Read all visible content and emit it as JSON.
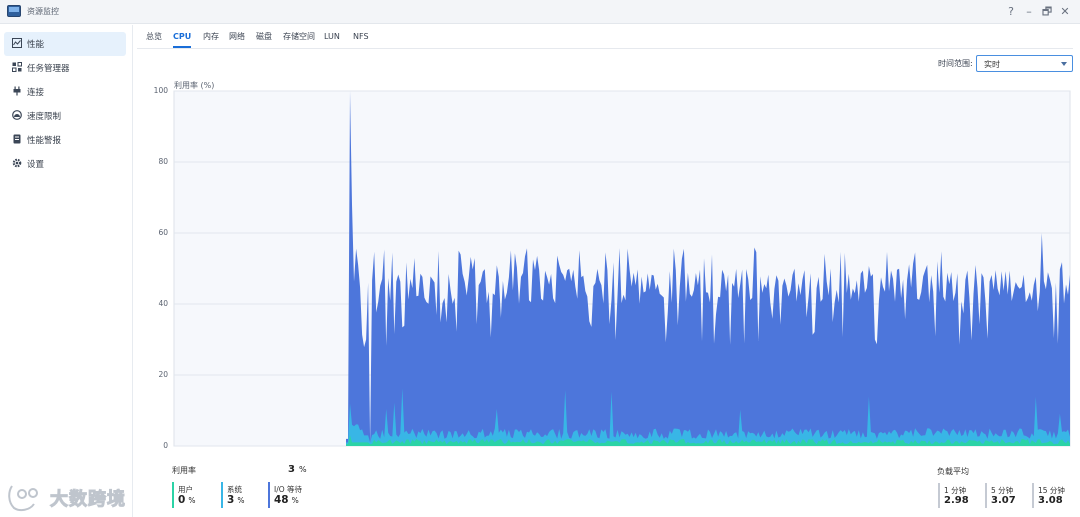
{
  "window": {
    "title": "资源监控",
    "controls": [
      "?",
      "–",
      "🗗",
      "✕"
    ]
  },
  "sidebar": {
    "items": [
      {
        "label": "性能",
        "icon": "performance-icon",
        "active": true
      },
      {
        "label": "任务管理器",
        "icon": "task-manager-icon",
        "active": false
      },
      {
        "label": "连接",
        "icon": "connection-icon",
        "active": false
      },
      {
        "label": "速度限制",
        "icon": "speed-limit-icon",
        "active": false
      },
      {
        "label": "性能警报",
        "icon": "alert-icon",
        "active": false
      },
      {
        "label": "设置",
        "icon": "gear-icon",
        "active": false
      }
    ]
  },
  "tabs": [
    "总览",
    "CPU",
    "内存",
    "网络",
    "磁盘",
    "存储空间",
    "LUN",
    "NFS"
  ],
  "active_tab": "CPU",
  "time_range": {
    "label": "时间范围:",
    "value": "实时"
  },
  "colors": {
    "io_wait": "#4d76db",
    "system": "#38b6e6",
    "user": "#2bd3a6",
    "accent": "#1a6ed8"
  },
  "chart_data": {
    "type": "area",
    "ylabel": "利用率 (%)",
    "ylim": [
      0,
      100
    ],
    "yticks": [
      0,
      20,
      40,
      60,
      80,
      100
    ],
    "grid": true,
    "series": [
      {
        "name": "I/O 等待",
        "approx_level_after_spike": 45,
        "peak": 100
      },
      {
        "name": "系统",
        "approx_level_after_spike": 4
      },
      {
        "name": "用户",
        "approx_level_after_spike": 1
      }
    ]
  },
  "utilization": {
    "label": "利用率",
    "value": "3",
    "unit": "%"
  },
  "stats": [
    {
      "label": "用户",
      "value": "0",
      "unit": "%",
      "color": "#2bd3a6"
    },
    {
      "label": "系统",
      "value": "3",
      "unit": "%",
      "color": "#38b6e6"
    },
    {
      "label": "I/O 等待",
      "value": "48",
      "unit": "%",
      "color": "#4d76db"
    }
  ],
  "load_average": {
    "title": "负载平均",
    "items": [
      {
        "label": "1 分钟",
        "value": "2.98"
      },
      {
        "label": "5 分钟",
        "value": "3.07"
      },
      {
        "label": "15 分钟",
        "value": "3.08"
      }
    ]
  },
  "watermark": {
    "text": "大数跨境"
  }
}
